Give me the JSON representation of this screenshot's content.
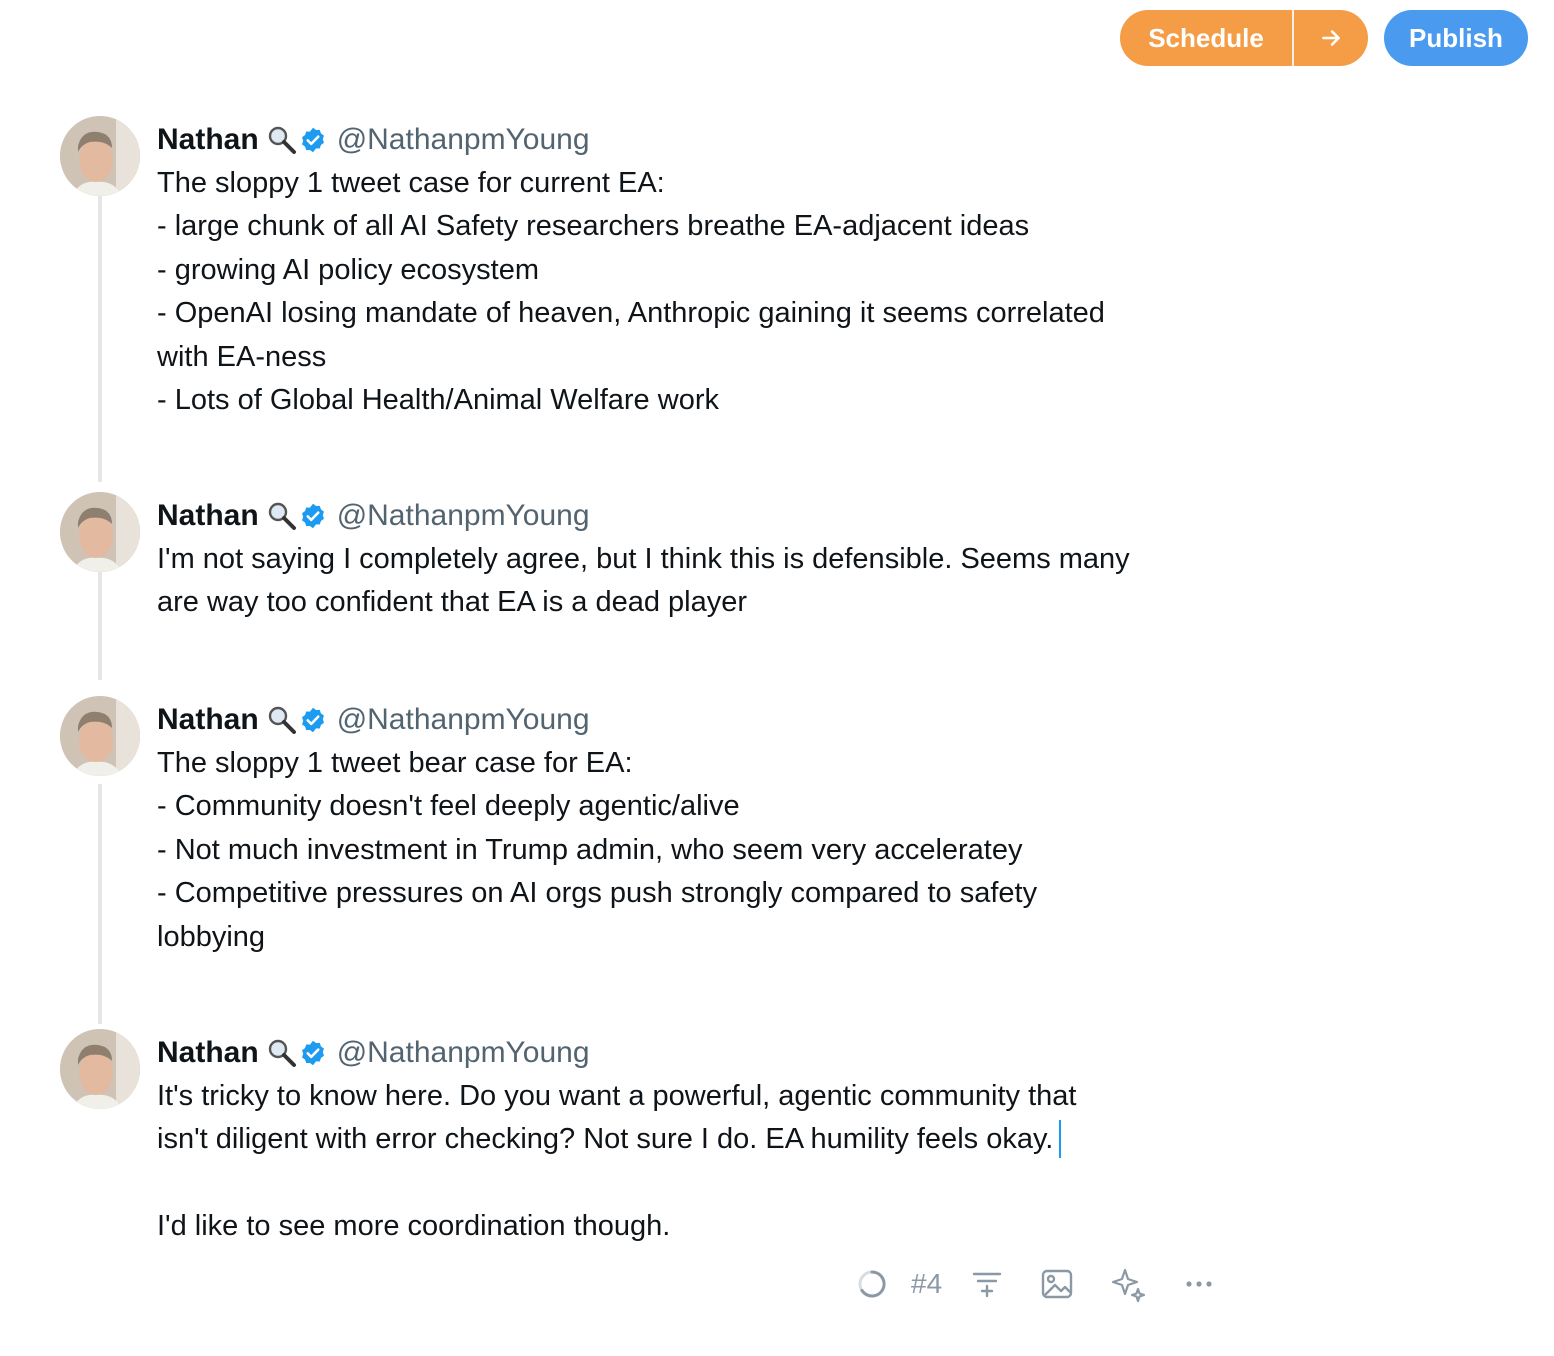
{
  "toolbar_top": {
    "schedule_label": "Schedule",
    "publish_label": "Publish"
  },
  "author": {
    "name": "Nathan",
    "handle": "@NathanpmYoung"
  },
  "tweets": [
    {
      "lines": [
        "The sloppy 1 tweet case for current EA:",
        "- large chunk of all AI Safety researchers breathe EA-adjacent ideas",
        "- growing AI policy ecosystem",
        "- OpenAI losing mandate of heaven, Anthropic gaining it seems correlated",
        "with EA-ness",
        "- Lots of Global Health/Animal Welfare work"
      ]
    },
    {
      "lines": [
        "I'm not saying I completely agree, but I think this is defensible. Seems many",
        "are way too confident that EA is a dead player"
      ]
    },
    {
      "lines": [
        "The sloppy 1 tweet bear case for EA:",
        "- Community doesn't feel deeply agentic/alive",
        "- Not much investment in Trump admin, who seem very acceleratey",
        "- Competitive pressures on AI orgs push strongly compared to safety",
        "lobbying"
      ]
    },
    {
      "lines": [
        "It's tricky to know here. Do you want a powerful, agentic community that",
        "isn't diligent with error checking? Not sure I do. EA humility feels okay.",
        "",
        "I'd like to see more coordination though."
      ]
    }
  ],
  "editor_toolbar": {
    "counter": "#4",
    "icons": [
      "progress-ring-icon",
      "insert-divider-icon",
      "image-icon",
      "sparkle-icon",
      "more-icon"
    ]
  },
  "colors": {
    "schedule": "#f59d46",
    "publish": "#4a9bf0",
    "verified": "#1d9bf0",
    "handle": "#536471"
  }
}
